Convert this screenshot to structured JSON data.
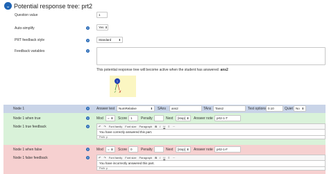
{
  "header": {
    "title": "Potential response tree: prt2"
  },
  "fields": {
    "question_value": {
      "label": "Question value",
      "value": "1"
    },
    "auto_simplify": {
      "label": "Auto-simplify",
      "value": "Yes"
    },
    "prt_feedback_style": {
      "label": "PRT feedback style",
      "value": "Standard"
    },
    "feedback_variables": {
      "label": "Feedback variables"
    }
  },
  "activation_note": {
    "prefix": "This potential response tree will become active when the student has answered:",
    "answer": "ans2"
  },
  "graph": {
    "node_label": "1",
    "true_mark": "✓",
    "false_mark": "✗"
  },
  "node": {
    "label": "Node 1",
    "answer_test_label": "Answer test",
    "answer_test_value": "NumRelative",
    "sans_label": "SAns",
    "sans_value": "ans2",
    "tans_label": "TAns",
    "tans_value": "Tans2",
    "test_options_label": "Test options",
    "test_options_value": "0.10",
    "quiet_label": "Quiet",
    "quiet_value": "No"
  },
  "true_branch": {
    "label": "Node 1 when true",
    "mod_label": "Mod",
    "mod_value": "=",
    "score_label": "Score",
    "score_value": "1",
    "penalty_label": "Penalty",
    "penalty_value": "",
    "next_label": "Next",
    "next_value": "[stop]",
    "answer_note_label": "Answer note",
    "answer_note_value": "prt2-1-T",
    "feedback_label": "Node 1 true feedback",
    "feedback_text": "You have correctly answered this part.",
    "path": "Path: p"
  },
  "false_branch": {
    "label": "Node 1 when false",
    "mod_label": "Mod",
    "mod_value": "=",
    "score_label": "Score",
    "score_value": "0",
    "penalty_label": "Penalty",
    "penalty_value": "",
    "next_label": "Next",
    "next_value": "[stop]",
    "answer_note_label": "Answer note",
    "answer_note_value": "prt2-1-F",
    "feedback_label": "Node 1 false feedback",
    "feedback_text": "You have incorrectly answered this part.",
    "path": "Path: p"
  },
  "editor": {
    "font_family": "Font family",
    "font_size": "Font size",
    "paragraph": "Paragraph"
  },
  "icons": {
    "help": "?",
    "chevron": "⌄",
    "select_arrow": "⬍"
  },
  "colors": {
    "accent": "#1f64b4",
    "node_band": "#c9d4e8",
    "true_band": "#d9f2d9",
    "false_band": "#f6d0d0"
  }
}
